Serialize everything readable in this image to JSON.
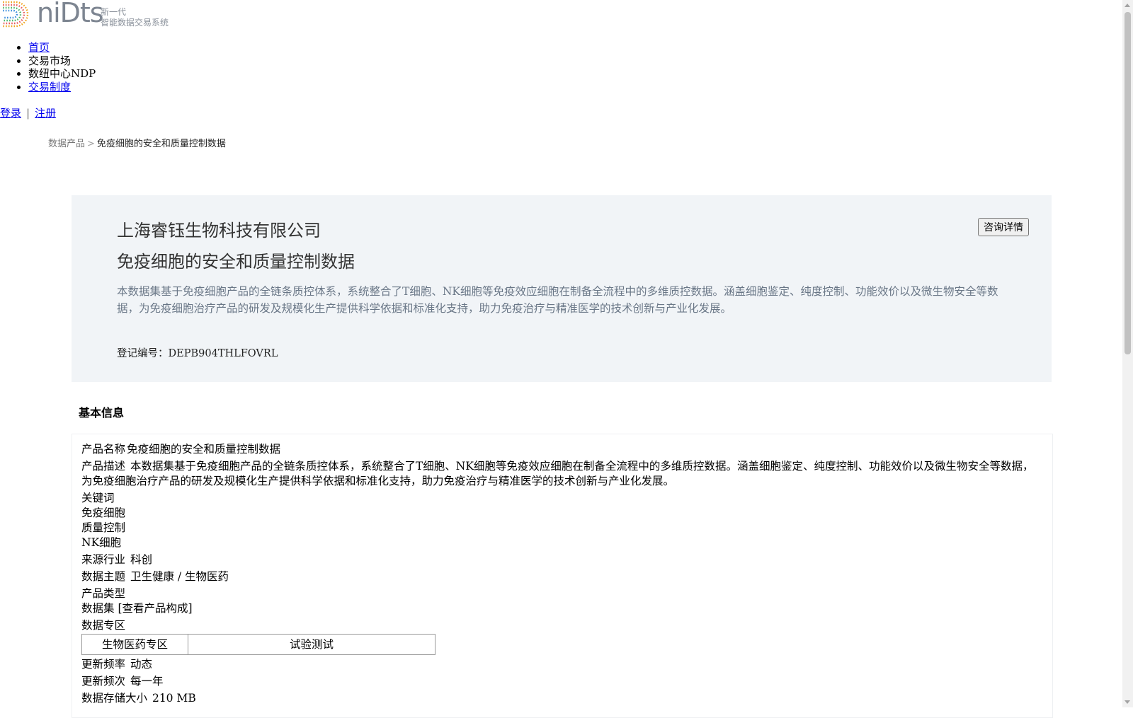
{
  "logo": {
    "word": "niDts",
    "sub_line1": "新一代",
    "sub_line2": "智能数据交易系统"
  },
  "nav": {
    "items": [
      {
        "label": "首页",
        "link": true
      },
      {
        "label": "交易市场",
        "link": false
      },
      {
        "label": "数纽中心NDP",
        "link": false
      },
      {
        "label": "交易制度",
        "link": true
      }
    ]
  },
  "auth": {
    "login": "登录",
    "separator": "|",
    "register": "注册"
  },
  "breadcrumb": {
    "parent": "数据产品",
    "arrow": ">",
    "current": "免疫细胞的安全和质量控制数据"
  },
  "hero": {
    "company": "上海睿钰生物科技有限公司",
    "title": "免疫细胞的安全和质量控制数据",
    "description": "本数据集基于免疫细胞产品的全链条质控体系，系统整合了T细胞、NK细胞等免疫效应细胞在制备全流程中的多维质控数据。涵盖细胞鉴定、纯度控制、功能效价以及微生物安全等数据，为免疫细胞治疗产品的研发及规模化生产提供科学依据和标准化支持，助力免疫治疗与精准医学的技术创新与产业化发展。",
    "reg_label": "登记编号：",
    "reg_no": "DEPB904THLFOVRL",
    "consult_button": "咨询详情"
  },
  "basic_info": {
    "section_title": "基本信息",
    "product_name_label": "产品名称",
    "product_name": "免疫细胞的安全和质量控制数据",
    "product_desc_label": "产品描述",
    "product_desc": "本数据集基于免疫细胞产品的全链条质控体系，系统整合了T细胞、NK细胞等免疫效应细胞在制备全流程中的多维质控数据。涵盖细胞鉴定、纯度控制、功能效价以及微生物安全等数据，为免疫细胞治疗产品的研发及规模化生产提供科学依据和标准化支持，助力免疫治疗与精准医学的技术创新与产业化发展。",
    "keywords_label": "关键词",
    "keywords": [
      "免疫细胞",
      "质量控制",
      "NK细胞"
    ],
    "industry_label": "来源行业",
    "industry": "科创",
    "topic_label": "数据主题",
    "topic": "卫生健康 / 生物医药",
    "type_label": "产品类型",
    "type": "数据集",
    "type_link": "[查看产品构成]",
    "zone_label": "数据专区",
    "zones": [
      "生物医药专区",
      "试验测试"
    ],
    "freq_label": "更新频率",
    "freq": "动态",
    "times_label": "更新频次",
    "times": "每一年",
    "size_label": "数据存储大小",
    "size": "210 MB"
  },
  "colors": {
    "hero_bg": "#f1f4f7",
    "desc_text": "#6a7787",
    "link": "#0000ee"
  }
}
